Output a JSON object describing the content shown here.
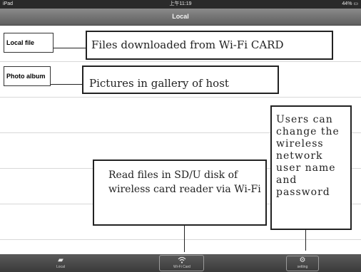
{
  "status_bar": {
    "device": "iPad",
    "time": "上午11:19",
    "battery": "44%"
  },
  "nav_bar": {
    "title": "Local"
  },
  "list": {
    "local_file_label": "Local file",
    "photo_album_label": "Photo album"
  },
  "annotations": {
    "local_file": "Files downloaded from Wi-Fi CARD",
    "photo_album": "Pictures in gallery of host",
    "wifi_card": "Read files in SD/U disk of wireless card reader via Wi-Fi",
    "setting": "Users can change the wireless network user name and password"
  },
  "tab_bar": {
    "tabs": [
      {
        "label": "Local",
        "icon": "folder-icon"
      },
      {
        "label": "Wi-Fi Card",
        "icon": "wifi-icon"
      },
      {
        "label": "setting",
        "icon": "gear-icon"
      }
    ]
  }
}
